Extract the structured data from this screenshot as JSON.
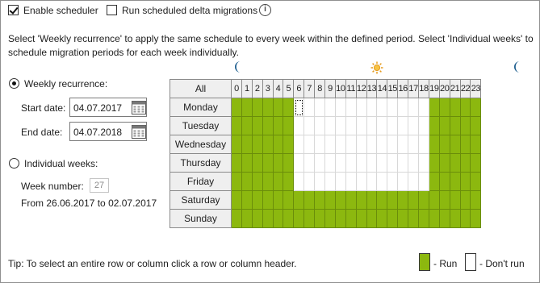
{
  "scheduler": {
    "enable_label": "Enable scheduler",
    "enable_checked": true,
    "delta_label": "Run scheduled delta migrations",
    "delta_checked": false
  },
  "description": {
    "line1": "Select 'Weekly recurrence' to apply the same schedule to every week within the defined period. Select 'Individual weeks' to",
    "line2": "schedule migration periods for each week individually."
  },
  "weekly": {
    "label": "Weekly recurrence:",
    "selected": true,
    "start_label": "Start date:",
    "start_value": "04.07.2017",
    "end_label": "End date:",
    "end_value": "04.07.2018"
  },
  "individual": {
    "label": "Individual weeks:",
    "selected": false,
    "week_label": "Week number:",
    "week_value": "27",
    "range_text": "From 26.06.2017 to 02.07.2017"
  },
  "grid": {
    "all_label": "All",
    "hours": [
      "0",
      "1",
      "2",
      "3",
      "4",
      "5",
      "6",
      "7",
      "8",
      "9",
      "10",
      "11",
      "12",
      "13",
      "14",
      "15",
      "16",
      "17",
      "18",
      "19",
      "20",
      "21",
      "22",
      "23"
    ],
    "days": [
      {
        "name": "Monday",
        "run": [
          1,
          1,
          1,
          1,
          1,
          1,
          0,
          0,
          0,
          0,
          0,
          0,
          0,
          0,
          0,
          0,
          0,
          0,
          0,
          1,
          1,
          1,
          1,
          1
        ]
      },
      {
        "name": "Tuesday",
        "run": [
          1,
          1,
          1,
          1,
          1,
          1,
          0,
          0,
          0,
          0,
          0,
          0,
          0,
          0,
          0,
          0,
          0,
          0,
          0,
          1,
          1,
          1,
          1,
          1
        ]
      },
      {
        "name": "Wednesday",
        "run": [
          1,
          1,
          1,
          1,
          1,
          1,
          0,
          0,
          0,
          0,
          0,
          0,
          0,
          0,
          0,
          0,
          0,
          0,
          0,
          1,
          1,
          1,
          1,
          1
        ]
      },
      {
        "name": "Thursday",
        "run": [
          1,
          1,
          1,
          1,
          1,
          1,
          0,
          0,
          0,
          0,
          0,
          0,
          0,
          0,
          0,
          0,
          0,
          0,
          0,
          1,
          1,
          1,
          1,
          1
        ]
      },
      {
        "name": "Friday",
        "run": [
          1,
          1,
          1,
          1,
          1,
          1,
          0,
          0,
          0,
          0,
          0,
          0,
          0,
          0,
          0,
          0,
          0,
          0,
          0,
          1,
          1,
          1,
          1,
          1
        ]
      },
      {
        "name": "Saturday",
        "run": [
          1,
          1,
          1,
          1,
          1,
          1,
          1,
          1,
          1,
          1,
          1,
          1,
          1,
          1,
          1,
          1,
          1,
          1,
          1,
          1,
          1,
          1,
          1,
          1
        ]
      },
      {
        "name": "Sunday",
        "run": [
          1,
          1,
          1,
          1,
          1,
          1,
          1,
          1,
          1,
          1,
          1,
          1,
          1,
          1,
          1,
          1,
          1,
          1,
          1,
          1,
          1,
          1,
          1,
          1
        ]
      }
    ],
    "icons": {
      "night": "moon-icon",
      "day": "sun-icon"
    }
  },
  "footer": {
    "tip": "Tip: To select an entire row or column click a row or column header.",
    "run_label": "- Run",
    "dont_run_label": "- Don't run"
  },
  "colors": {
    "run": "#8cb80f",
    "moon": "#1f5f8f",
    "sun": "#e59a1d"
  }
}
